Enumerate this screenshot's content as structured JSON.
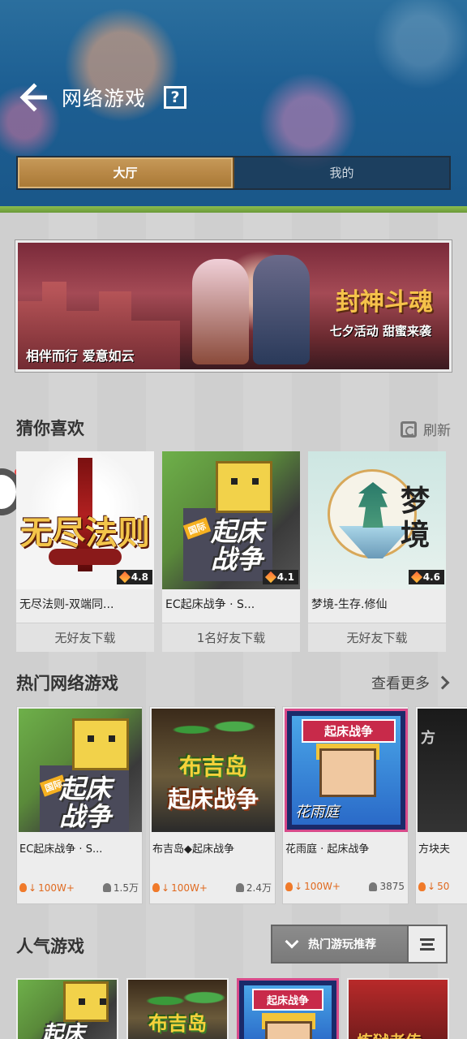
{
  "header": {
    "title": "网络游戏",
    "help": "?",
    "tabs": [
      {
        "label": "大厅",
        "active": true
      },
      {
        "label": "我的",
        "active": false
      }
    ]
  },
  "banner": {
    "title": "封神斗魂",
    "subtitle": "七夕活动 甜蜜来袭",
    "slogan": "相伴而行 爱意如云"
  },
  "guess": {
    "title": "猜你喜欢",
    "refresh_label": "刷新",
    "cards": [
      {
        "logo": "无尽法则",
        "rating": "4.8",
        "name": "无尽法则-双端同...",
        "friends": "无好友下载"
      },
      {
        "logo_tag": "国际",
        "logo": "起床战争",
        "rating": "4.1",
        "name": "EC起床战争 · S...",
        "friends": "1名好友下载"
      },
      {
        "logo": "梦境",
        "rating": "4.6",
        "name": "梦境-生存.修仙",
        "friends": "无好友下载"
      }
    ]
  },
  "hot": {
    "title": "热门网络游戏",
    "more_label": "查看更多",
    "cards": [
      {
        "logo_tag": "国际",
        "logo": "起床战争",
        "name": "EC起床战争 · S...",
        "downloads": "100W+",
        "players": "1.5万"
      },
      {
        "logo1": "布吉岛",
        "logo2": "起床战争",
        "name": "布吉岛◆起床战争",
        "downloads": "100W+",
        "players": "2.4万"
      },
      {
        "logo_header": "起床战争",
        "logo_sig": "花雨庭",
        "name": "花雨庭 · 起床战争",
        "downloads": "100W+",
        "players": "3875"
      },
      {
        "logo": "方",
        "name": "方块夫",
        "downloads": "50",
        "players": ""
      }
    ]
  },
  "popular": {
    "title": "人气游戏",
    "dropdown_label": "热门游玩推荐",
    "cards": [
      {
        "logo": "起床"
      },
      {
        "logo": "布吉岛"
      },
      {
        "logo": "起床战争"
      },
      {
        "logo": "炼狱者传"
      }
    ]
  },
  "colors": {
    "tab_active": "#b88846",
    "header_bg": "#1d5f93",
    "download_accent": "#e06a20"
  }
}
